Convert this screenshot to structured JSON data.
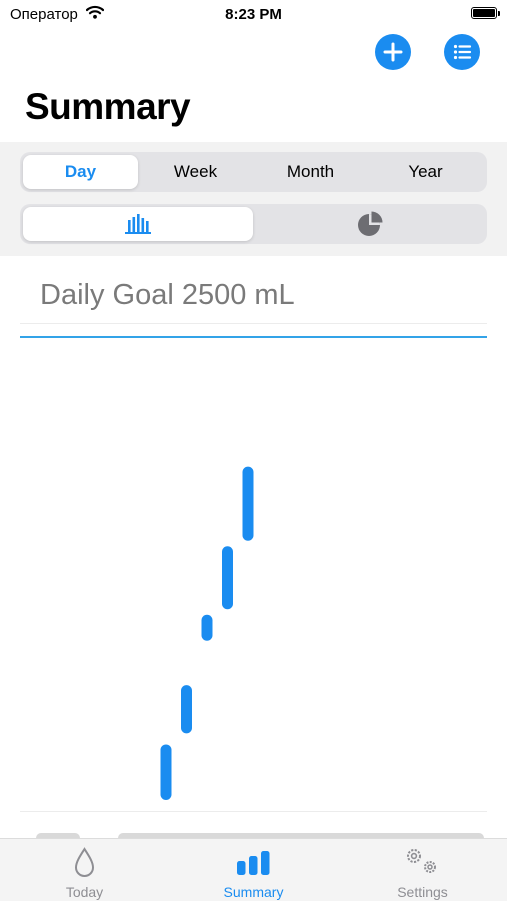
{
  "status_bar": {
    "carrier": "Оператор",
    "time": "8:23 PM"
  },
  "header": {
    "title": "Summary"
  },
  "period_control": {
    "options": [
      "Day",
      "Week",
      "Month",
      "Year"
    ],
    "selected": "Day"
  },
  "chart_toggle": {
    "options": [
      "bar-chart-icon",
      "pie-chart-icon"
    ],
    "selected": "bar-chart-icon"
  },
  "goal": {
    "label": "Daily Goal 2500 mL"
  },
  "tab_bar": {
    "items": [
      {
        "label": "Today",
        "icon": "drop-icon"
      },
      {
        "label": "Summary",
        "icon": "bar-chart-icon"
      },
      {
        "label": "Settings",
        "icon": "gears-icon"
      }
    ],
    "selected": "Summary"
  },
  "colors": {
    "accent": "#1a8cf0",
    "goal_line": "#33a3e8"
  },
  "chart_data": {
    "type": "bar",
    "title": "",
    "xlabel": "",
    "ylabel": "",
    "ylim": [
      0,
      2500
    ],
    "goal": 2500,
    "series": [
      {
        "name": "",
        "ranges": [
          [
            0,
            300
          ],
          [
            360,
            620
          ],
          [
            860,
            1000
          ],
          [
            1030,
            1370
          ],
          [
            1400,
            1800
          ]
        ]
      }
    ]
  }
}
